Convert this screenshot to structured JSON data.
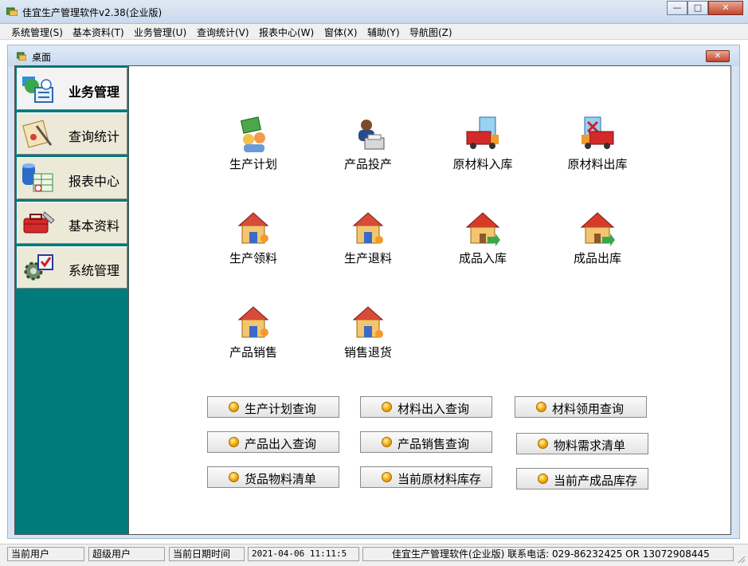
{
  "app": {
    "title": "佳宜生产管理软件v2.38(企业版)"
  },
  "window_buttons": {
    "minimize": "—",
    "maximize": "□",
    "close": "✕"
  },
  "menu": [
    "系统管理(S)",
    "基本资料(T)",
    "业务管理(U)",
    "查询统计(V)",
    "报表中心(W)",
    "窗体(X)",
    "辅助(Y)",
    "导航图(Z)"
  ],
  "mdi": {
    "title": "桌面",
    "close": "✕"
  },
  "sidebar": {
    "items": [
      {
        "label": "业务管理",
        "icon": "business-icon",
        "active": true
      },
      {
        "label": "查询统计",
        "icon": "query-icon",
        "active": false
      },
      {
        "label": "报表中心",
        "icon": "report-icon",
        "active": false
      },
      {
        "label": "基本资料",
        "icon": "toolbox-icon",
        "active": false
      },
      {
        "label": "系统管理",
        "icon": "settings-icon",
        "active": false
      }
    ],
    "bg_color": "#007a7a"
  },
  "functions": [
    {
      "label": "生产计划",
      "icon": "production-plan-icon"
    },
    {
      "label": "产品投产",
      "icon": "product-launch-icon"
    },
    {
      "label": "原材料入库",
      "icon": "material-inbound-icon"
    },
    {
      "label": "原材料出库",
      "icon": "material-outbound-icon"
    },
    {
      "label": "生产领料",
      "icon": "production-pick-icon"
    },
    {
      "label": "生产退料",
      "icon": "production-return-icon"
    },
    {
      "label": "成品入库",
      "icon": "finished-inbound-icon"
    },
    {
      "label": "成品出库",
      "icon": "finished-outbound-icon"
    },
    {
      "label": "产品销售",
      "icon": "product-sales-icon"
    },
    {
      "label": "销售退货",
      "icon": "sales-return-icon"
    }
  ],
  "quick_buttons": [
    "生产计划查询",
    "材料出入查询",
    "材料领用查询",
    "产品出入查询",
    "产品销售查询",
    "物料需求清单",
    "货品物料清单",
    "当前原材料库存",
    "当前产成品库存"
  ],
  "status": {
    "current_user_label": "当前用户",
    "current_user_value": "超级用户",
    "datetime_label": "当前日期时间",
    "datetime_value": "2021-04-06 11:11:5",
    "info": "佳宜生产管理软件(企业版) 联系电话: 029-86232425 OR 13072908445"
  }
}
